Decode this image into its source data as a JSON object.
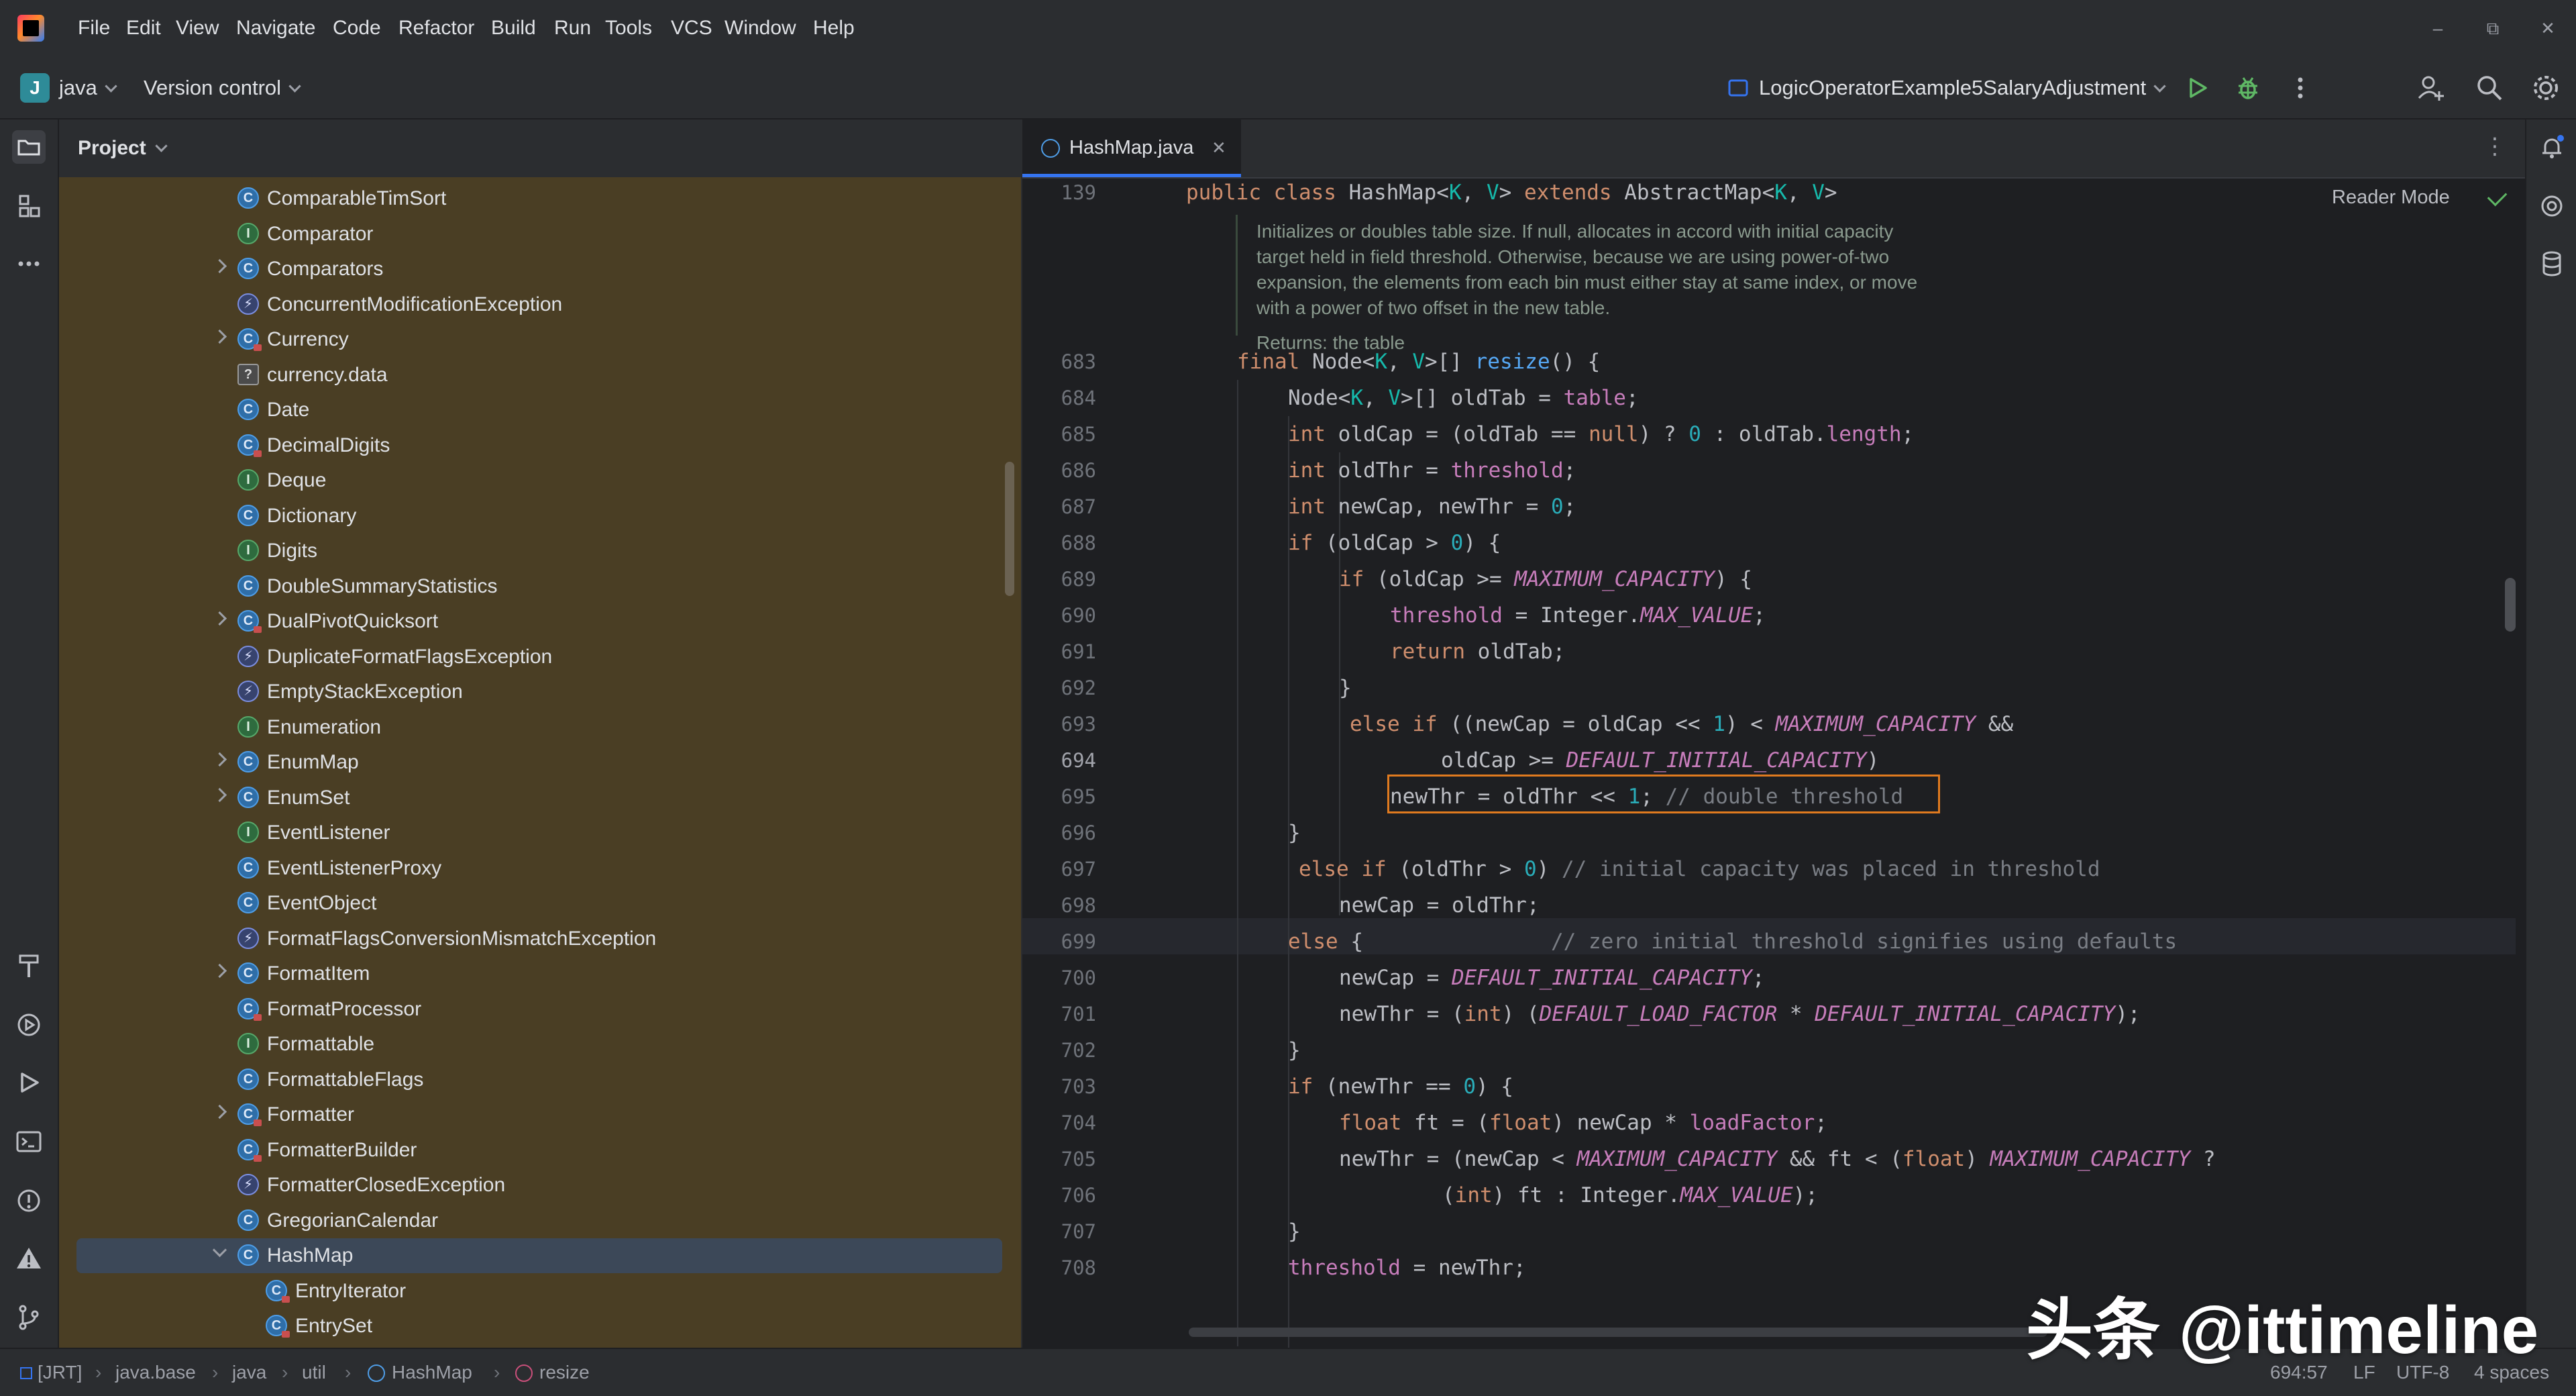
{
  "menu": [
    "File",
    "Edit",
    "View",
    "Navigate",
    "Code",
    "Refactor",
    "Build",
    "Run",
    "Tools",
    "VCS",
    "Window",
    "Help"
  ],
  "toolbar": {
    "project_badge": "J",
    "project_name": "java",
    "vcs_label": "Version control",
    "run_config": "LogicOperatorExample5SalaryAdjustment"
  },
  "project_panel": {
    "title": "Project",
    "items": [
      {
        "label": "ComparableTimSort",
        "icon": "class-icon",
        "arrow": false
      },
      {
        "label": "Comparator",
        "icon": "interface-icon",
        "arrow": false
      },
      {
        "label": "Comparators",
        "icon": "class-icon",
        "arrow": true
      },
      {
        "label": "ConcurrentModificationException",
        "icon": "exception-icon",
        "arrow": false
      },
      {
        "label": "Currency",
        "icon": "class-locked-icon",
        "arrow": true
      },
      {
        "label": "currency.data",
        "icon": "file-icon",
        "arrow": false
      },
      {
        "label": "Date",
        "icon": "class-icon",
        "arrow": false
      },
      {
        "label": "DecimalDigits",
        "icon": "class-locked-icon",
        "arrow": false
      },
      {
        "label": "Deque",
        "icon": "interface-icon",
        "arrow": false
      },
      {
        "label": "Dictionary",
        "icon": "class-icon",
        "arrow": false
      },
      {
        "label": "Digits",
        "icon": "interface-icon",
        "arrow": false
      },
      {
        "label": "DoubleSummaryStatistics",
        "icon": "class-icon",
        "arrow": false
      },
      {
        "label": "DualPivotQuicksort",
        "icon": "class-locked-icon",
        "arrow": true
      },
      {
        "label": "DuplicateFormatFlagsException",
        "icon": "exception-icon",
        "arrow": false
      },
      {
        "label": "EmptyStackException",
        "icon": "exception-icon",
        "arrow": false
      },
      {
        "label": "Enumeration",
        "icon": "interface-icon",
        "arrow": false
      },
      {
        "label": "EnumMap",
        "icon": "class-icon",
        "arrow": true
      },
      {
        "label": "EnumSet",
        "icon": "class-icon",
        "arrow": true
      },
      {
        "label": "EventListener",
        "icon": "interface-icon",
        "arrow": false
      },
      {
        "label": "EventListenerProxy",
        "icon": "class-icon",
        "arrow": false
      },
      {
        "label": "EventObject",
        "icon": "class-icon",
        "arrow": false
      },
      {
        "label": "FormatFlagsConversionMismatchException",
        "icon": "exception-icon",
        "arrow": false
      },
      {
        "label": "FormatItem",
        "icon": "class-icon",
        "arrow": true
      },
      {
        "label": "FormatProcessor",
        "icon": "class-locked-icon",
        "arrow": false
      },
      {
        "label": "Formattable",
        "icon": "interface-icon",
        "arrow": false
      },
      {
        "label": "FormattableFlags",
        "icon": "class-icon",
        "arrow": false
      },
      {
        "label": "Formatter",
        "icon": "class-locked-icon",
        "arrow": true
      },
      {
        "label": "FormatterBuilder",
        "icon": "class-locked-icon",
        "arrow": false
      },
      {
        "label": "FormatterClosedException",
        "icon": "exception-icon",
        "arrow": false
      },
      {
        "label": "GregorianCalendar",
        "icon": "class-icon",
        "arrow": false
      },
      {
        "label": "HashMap",
        "icon": "class-icon",
        "arrow": true,
        "open": true,
        "selected": true
      },
      {
        "label": "EntryIterator",
        "icon": "class-locked-icon",
        "arrow": false,
        "child": true
      },
      {
        "label": "EntrySet",
        "icon": "class-locked-icon",
        "arrow": false,
        "child": true
      }
    ]
  },
  "editor": {
    "tab_label": "HashMap.java",
    "reader_mode": "Reader Mode",
    "doc": {
      "lines": [
        "Initializes or doubles table size. If null, allocates in accord with initial capacity",
        "target held in field threshold. Otherwise, because we are using power-of-two",
        "expansion, the elements from each bin must either stay at same index, or move",
        "with a power of two offset in the new table."
      ],
      "returns": "Returns: the table"
    },
    "header_line": {
      "number": "139"
    },
    "lines": [
      {
        "n": "683"
      },
      {
        "n": "684"
      },
      {
        "n": "685"
      },
      {
        "n": "686"
      },
      {
        "n": "687"
      },
      {
        "n": "688"
      },
      {
        "n": "689"
      },
      {
        "n": "690"
      },
      {
        "n": "691"
      },
      {
        "n": "692"
      },
      {
        "n": "693"
      },
      {
        "n": "694"
      },
      {
        "n": "695"
      },
      {
        "n": "696"
      },
      {
        "n": "697"
      },
      {
        "n": "698"
      },
      {
        "n": "699"
      },
      {
        "n": "700"
      },
      {
        "n": "701"
      },
      {
        "n": "702"
      },
      {
        "n": "703"
      },
      {
        "n": "704"
      },
      {
        "n": "705"
      },
      {
        "n": "706"
      },
      {
        "n": "707"
      },
      {
        "n": "708"
      }
    ],
    "comments": {
      "c695": "// double threshold",
      "c697": "// initial capacity was placed in threshold",
      "c699": "// zero initial threshold signifies using defaults"
    }
  },
  "statusbar": {
    "crumbs": [
      "[JRT]",
      "java.base",
      "java",
      "util",
      "HashMap",
      "resize"
    ],
    "position": "694:57",
    "line_sep": "LF",
    "encoding": "UTF-8",
    "indent": "4 spaces"
  },
  "watermark": "头条 @ittimeline"
}
